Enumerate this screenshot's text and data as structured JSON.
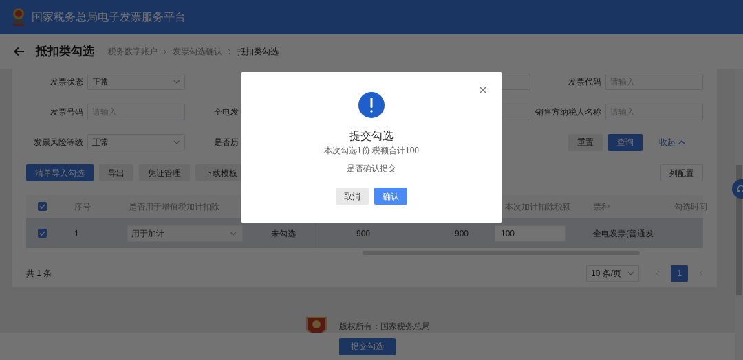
{
  "header": {
    "title": "国家税务总局电子发票服务平台"
  },
  "breadcrumb": {
    "page_title": "抵扣类勾选",
    "items": [
      {
        "label": "税务数字账户",
        "current": false
      },
      {
        "label": "发票勾选确认",
        "current": false
      },
      {
        "label": "抵扣类勾选",
        "current": true
      }
    ]
  },
  "filter_rows": [
    [
      {
        "kind": "select",
        "label": "发票状态",
        "value": "正常"
      },
      {
        "kind": "gap"
      },
      {
        "kind": "field"
      },
      {
        "kind": "input",
        "label": "发票代码",
        "placeholder": "请输入"
      }
    ],
    [
      {
        "kind": "input",
        "label": "发票号码",
        "placeholder": "请输入"
      },
      {
        "kind": "label",
        "label": "全电发"
      },
      {
        "kind": "field"
      },
      {
        "kind": "input",
        "label": "销售方纳税人名称",
        "placeholder": "请输入"
      }
    ],
    [
      {
        "kind": "select",
        "label": "发票风险等级",
        "value": "正常"
      },
      {
        "kind": "label",
        "label": "是否历"
      }
    ]
  ],
  "filter_actions": {
    "reset": "重置",
    "search": "查询",
    "collapse": "收起"
  },
  "toolbar": [
    {
      "label": "清单导入勾选",
      "primary": true
    },
    {
      "label": "导出",
      "primary": false
    },
    {
      "label": "凭证管理",
      "primary": false
    },
    {
      "label": "下载模板",
      "primary": false
    }
  ],
  "column_config": "列配置",
  "table": {
    "select_all_checked": true,
    "columns": [
      "序号",
      "是否用于增值税加计扣除",
      "本次加计扣除税额",
      "票种",
      "勾选时间"
    ],
    "rows": [
      {
        "checked": true,
        "index": "1",
        "deduction_use": "用于加计",
        "status": "未勾选",
        "column_5": "900",
        "column_6": "900",
        "deduction_amount": "100",
        "invoice_type": "全电发票(普通发"
      }
    ]
  },
  "pagination": {
    "total": "共 1 条",
    "page_size": "10 条/页",
    "pages": [
      {
        "label": "1",
        "selected": true
      }
    ]
  },
  "footer": {
    "copyright": "版权所有：国家税务总局"
  },
  "submit_button": "提交勾选",
  "dialog": {
    "title": "提交勾选",
    "summary": "本次勾选1份,税额合计100",
    "question": "是否确认提交",
    "cancel": "取消",
    "confirm": "确认"
  }
}
